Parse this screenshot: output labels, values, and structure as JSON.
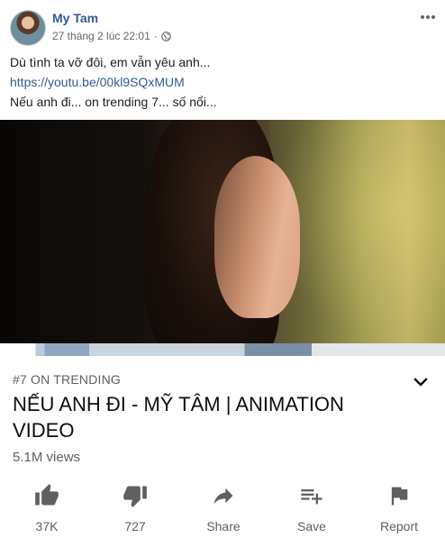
{
  "post": {
    "author": "My Tam",
    "timestamp": "27 tháng 2 lúc 22:01",
    "separator": "·",
    "privacy_icon": "globe-icon",
    "more_icon": "more-dots-icon",
    "lines": {
      "line1": "Dù tình ta vỡ đôi, em vẫn yêu anh...",
      "link": "https://youtu.be/00kl9SQxMUM",
      "line3": "Nếu anh đi... on trending 7... số nổi..."
    }
  },
  "video": {
    "trending_label": "#7 ON TRENDING",
    "title": "NẾU ANH ĐI - MỸ TÂM | ANIMATION VIDEO",
    "views": "5.1M views",
    "expand_icon": "chevron-down-icon",
    "actions": {
      "like": {
        "icon": "thumbs-up-icon",
        "label": "37K"
      },
      "dislike": {
        "icon": "thumbs-down-icon",
        "label": "727"
      },
      "share": {
        "icon": "share-icon",
        "label": "Share"
      },
      "save": {
        "icon": "playlist-add-icon",
        "label": "Save"
      },
      "report": {
        "icon": "flag-icon",
        "label": "Report"
      }
    }
  },
  "colors": {
    "link_blue": "#385898",
    "meta_gray": "#616770",
    "yt_gray": "#606060"
  }
}
